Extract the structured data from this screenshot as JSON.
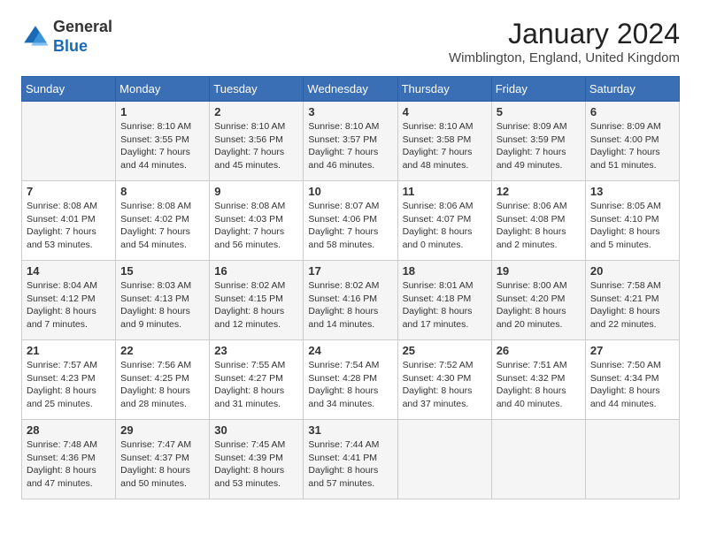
{
  "logo": {
    "text_general": "General",
    "text_blue": "Blue"
  },
  "title": "January 2024",
  "location": "Wimblington, England, United Kingdom",
  "days_of_week": [
    "Sunday",
    "Monday",
    "Tuesday",
    "Wednesday",
    "Thursday",
    "Friday",
    "Saturday"
  ],
  "weeks": [
    [
      {
        "day": "",
        "info": ""
      },
      {
        "day": "1",
        "info": "Sunrise: 8:10 AM\nSunset: 3:55 PM\nDaylight: 7 hours\nand 44 minutes."
      },
      {
        "day": "2",
        "info": "Sunrise: 8:10 AM\nSunset: 3:56 PM\nDaylight: 7 hours\nand 45 minutes."
      },
      {
        "day": "3",
        "info": "Sunrise: 8:10 AM\nSunset: 3:57 PM\nDaylight: 7 hours\nand 46 minutes."
      },
      {
        "day": "4",
        "info": "Sunrise: 8:10 AM\nSunset: 3:58 PM\nDaylight: 7 hours\nand 48 minutes."
      },
      {
        "day": "5",
        "info": "Sunrise: 8:09 AM\nSunset: 3:59 PM\nDaylight: 7 hours\nand 49 minutes."
      },
      {
        "day": "6",
        "info": "Sunrise: 8:09 AM\nSunset: 4:00 PM\nDaylight: 7 hours\nand 51 minutes."
      }
    ],
    [
      {
        "day": "7",
        "info": "Sunrise: 8:08 AM\nSunset: 4:01 PM\nDaylight: 7 hours\nand 53 minutes."
      },
      {
        "day": "8",
        "info": "Sunrise: 8:08 AM\nSunset: 4:02 PM\nDaylight: 7 hours\nand 54 minutes."
      },
      {
        "day": "9",
        "info": "Sunrise: 8:08 AM\nSunset: 4:03 PM\nDaylight: 7 hours\nand 56 minutes."
      },
      {
        "day": "10",
        "info": "Sunrise: 8:07 AM\nSunset: 4:06 PM\nDaylight: 7 hours\nand 58 minutes."
      },
      {
        "day": "11",
        "info": "Sunrise: 8:06 AM\nSunset: 4:07 PM\nDaylight: 8 hours\nand 0 minutes."
      },
      {
        "day": "12",
        "info": "Sunrise: 8:06 AM\nSunset: 4:08 PM\nDaylight: 8 hours\nand 2 minutes."
      },
      {
        "day": "13",
        "info": "Sunrise: 8:05 AM\nSunset: 4:10 PM\nDaylight: 8 hours\nand 5 minutes."
      }
    ],
    [
      {
        "day": "14",
        "info": "Sunrise: 8:04 AM\nSunset: 4:12 PM\nDaylight: 8 hours\nand 7 minutes."
      },
      {
        "day": "15",
        "info": "Sunrise: 8:03 AM\nSunset: 4:13 PM\nDaylight: 8 hours\nand 9 minutes."
      },
      {
        "day": "16",
        "info": "Sunrise: 8:02 AM\nSunset: 4:15 PM\nDaylight: 8 hours\nand 12 minutes."
      },
      {
        "day": "17",
        "info": "Sunrise: 8:02 AM\nSunset: 4:16 PM\nDaylight: 8 hours\nand 14 minutes."
      },
      {
        "day": "18",
        "info": "Sunrise: 8:01 AM\nSunset: 4:18 PM\nDaylight: 8 hours\nand 17 minutes."
      },
      {
        "day": "19",
        "info": "Sunrise: 8:00 AM\nSunset: 4:20 PM\nDaylight: 8 hours\nand 20 minutes."
      },
      {
        "day": "20",
        "info": "Sunrise: 7:58 AM\nSunset: 4:21 PM\nDaylight: 8 hours\nand 22 minutes."
      }
    ],
    [
      {
        "day": "21",
        "info": "Sunrise: 7:57 AM\nSunset: 4:23 PM\nDaylight: 8 hours\nand 25 minutes."
      },
      {
        "day": "22",
        "info": "Sunrise: 7:56 AM\nSunset: 4:25 PM\nDaylight: 8 hours\nand 28 minutes."
      },
      {
        "day": "23",
        "info": "Sunrise: 7:55 AM\nSunset: 4:27 PM\nDaylight: 8 hours\nand 31 minutes."
      },
      {
        "day": "24",
        "info": "Sunrise: 7:54 AM\nSunset: 4:28 PM\nDaylight: 8 hours\nand 34 minutes."
      },
      {
        "day": "25",
        "info": "Sunrise: 7:52 AM\nSunset: 4:30 PM\nDaylight: 8 hours\nand 37 minutes."
      },
      {
        "day": "26",
        "info": "Sunrise: 7:51 AM\nSunset: 4:32 PM\nDaylight: 8 hours\nand 40 minutes."
      },
      {
        "day": "27",
        "info": "Sunrise: 7:50 AM\nSunset: 4:34 PM\nDaylight: 8 hours\nand 44 minutes."
      }
    ],
    [
      {
        "day": "28",
        "info": "Sunrise: 7:48 AM\nSunset: 4:36 PM\nDaylight: 8 hours\nand 47 minutes."
      },
      {
        "day": "29",
        "info": "Sunrise: 7:47 AM\nSunset: 4:37 PM\nDaylight: 8 hours\nand 50 minutes."
      },
      {
        "day": "30",
        "info": "Sunrise: 7:45 AM\nSunset: 4:39 PM\nDaylight: 8 hours\nand 53 minutes."
      },
      {
        "day": "31",
        "info": "Sunrise: 7:44 AM\nSunset: 4:41 PM\nDaylight: 8 hours\nand 57 minutes."
      },
      {
        "day": "",
        "info": ""
      },
      {
        "day": "",
        "info": ""
      },
      {
        "day": "",
        "info": ""
      }
    ]
  ]
}
